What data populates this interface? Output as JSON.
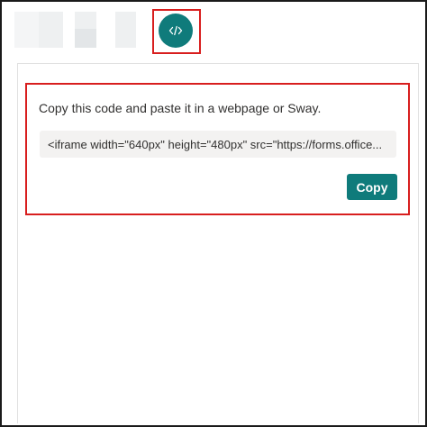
{
  "share_options": {
    "icons": [
      "link-icon",
      "qr-code-icon",
      "email-icon",
      "embed-code-icon"
    ],
    "active_icon_color": "#0f7b7b",
    "highlight_color": "#d81e1e"
  },
  "embed_panel": {
    "instruction": "Copy this code and paste it in a webpage or Sway.",
    "code": "<iframe width=\"640px\" height=\"480px\" src=\"https://forms.office...",
    "copy_label": "Copy"
  }
}
